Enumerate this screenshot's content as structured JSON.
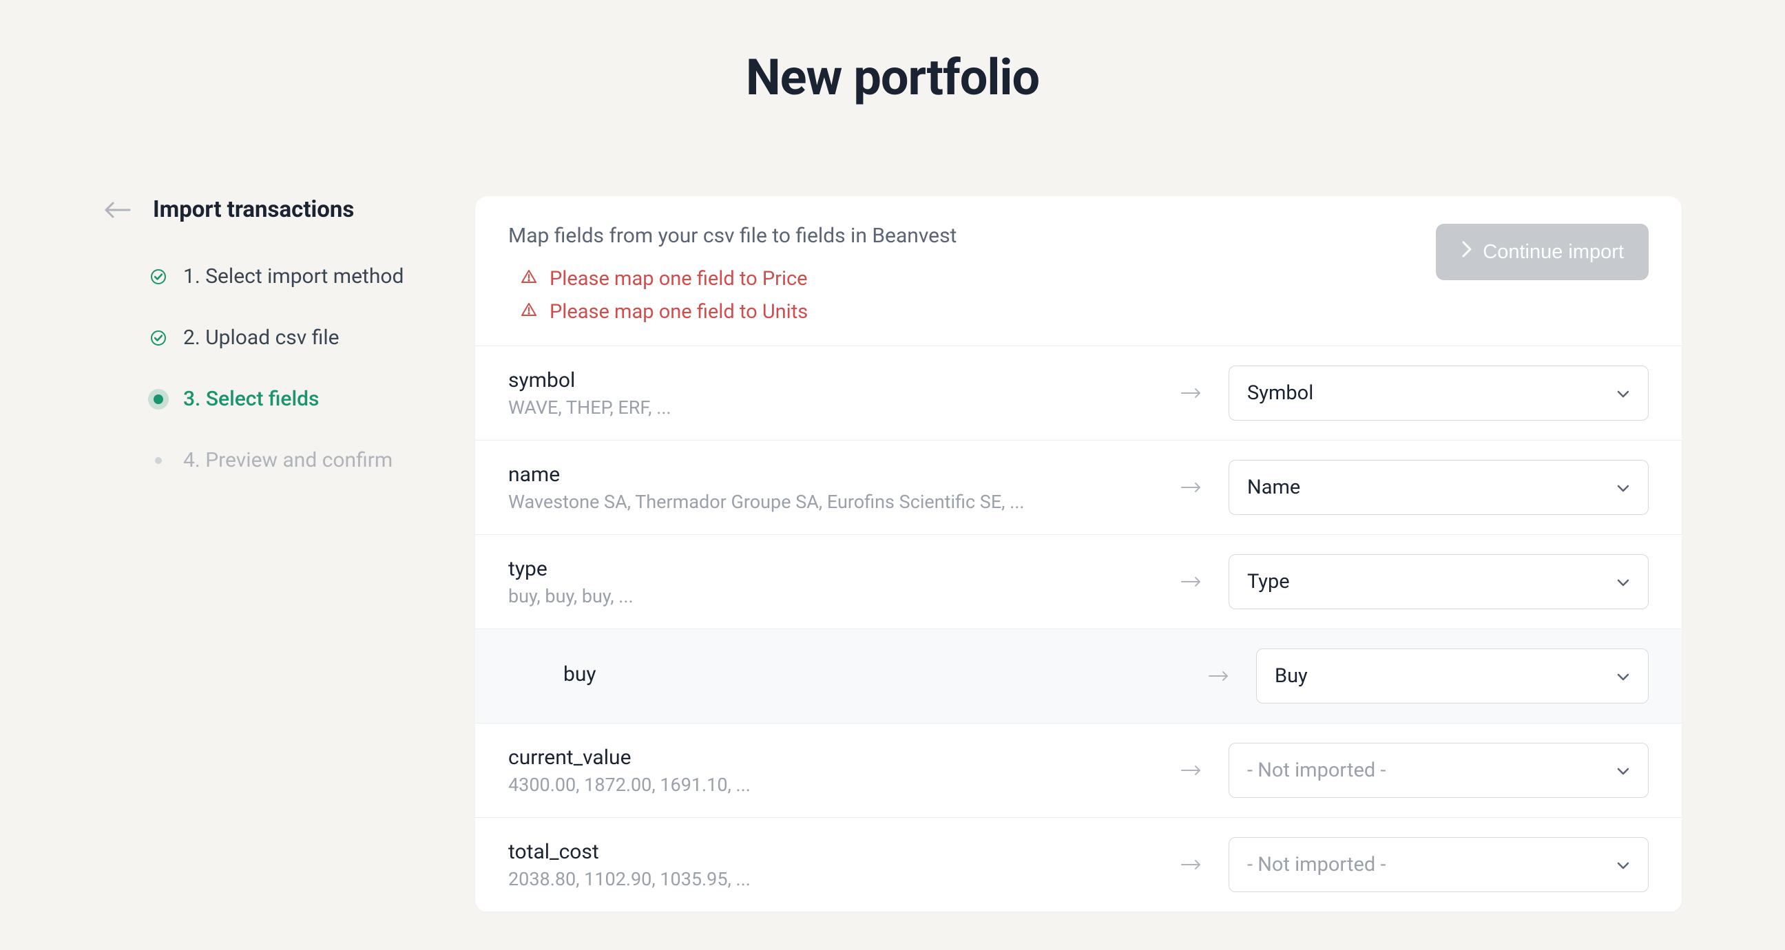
{
  "page_title": "New portfolio",
  "sidebar": {
    "title": "Import transactions",
    "steps": [
      {
        "label": "1. Select import method",
        "state": "completed"
      },
      {
        "label": "2. Upload csv file",
        "state": "completed"
      },
      {
        "label": "3. Select fields",
        "state": "current"
      },
      {
        "label": "4. Preview and confirm",
        "state": "upcoming"
      }
    ]
  },
  "instruction": "Map fields from your csv file to fields in Beanvest",
  "errors": [
    "Please map one field to Price",
    "Please map one field to Units"
  ],
  "continue_label": "Continue import",
  "not_imported_label": "- Not imported -",
  "fields": [
    {
      "csv_name": "symbol",
      "sample": "WAVE, THEP, ERF, ...",
      "mapped": "Symbol",
      "nested": false
    },
    {
      "csv_name": "name",
      "sample": "Wavestone SA, Thermador Groupe SA, Eurofins Scientific SE, ...",
      "mapped": "Name",
      "nested": false
    },
    {
      "csv_name": "type",
      "sample": "buy, buy, buy, ...",
      "mapped": "Type",
      "nested": false
    },
    {
      "csv_name": "buy",
      "sample": "",
      "mapped": "Buy",
      "nested": true
    },
    {
      "csv_name": "current_value",
      "sample": "4300.00, 1872.00, 1691.10, ...",
      "mapped": "",
      "nested": false
    },
    {
      "csv_name": "total_cost",
      "sample": "2038.80, 1102.90, 1035.95, ...",
      "mapped": "",
      "nested": false
    }
  ]
}
